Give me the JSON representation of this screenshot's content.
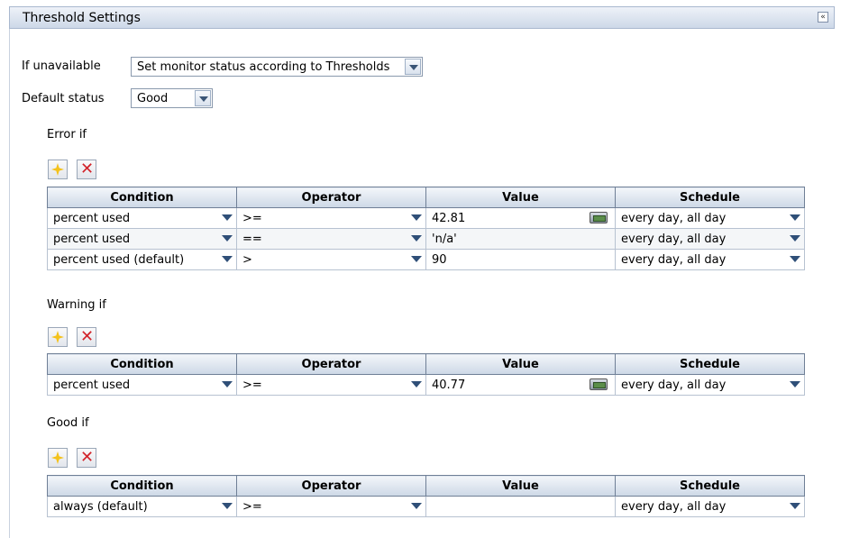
{
  "panel": {
    "title": "Threshold Settings",
    "collapse_glyph": "«"
  },
  "general": {
    "if_unavailable_label": "If unavailable",
    "if_unavailable_value": "Set monitor status according to Thresholds",
    "default_status_label": "Default status",
    "default_status_value": "Good"
  },
  "columns": {
    "condition": "Condition",
    "operator": "Operator",
    "value": "Value",
    "schedule": "Schedule"
  },
  "sections": {
    "error": {
      "label": "Error if",
      "rows": [
        {
          "condition": "percent used",
          "operator": ">=",
          "value": "42.81",
          "schedule": "every day, all day"
        },
        {
          "condition": "percent used",
          "operator": "==",
          "value": "'n/a'",
          "schedule": "every day, all day"
        },
        {
          "condition": "percent used (default)",
          "operator": ">",
          "value": "90",
          "schedule": "every day, all day"
        }
      ]
    },
    "warning": {
      "label": "Warning if",
      "rows": [
        {
          "condition": "percent used",
          "operator": ">=",
          "value": "40.77",
          "schedule": "every day, all day"
        }
      ]
    },
    "good": {
      "label": "Good if",
      "rows": [
        {
          "condition": "always (default)",
          "operator": ">=",
          "value": "",
          "schedule": "every day, all day"
        }
      ]
    }
  },
  "icons": {
    "add": "add-star-icon",
    "delete": "delete-x-icon",
    "editor": "value-editor-icon",
    "dropdown": "dropdown-arrow-icon"
  },
  "colors": {
    "header_gradient_top": "#eef2f8",
    "header_gradient_bottom": "#cdd8e8",
    "arrow": "#2f4f78",
    "delete_red": "#d2232a",
    "add_yellow": "#f4c21b"
  }
}
